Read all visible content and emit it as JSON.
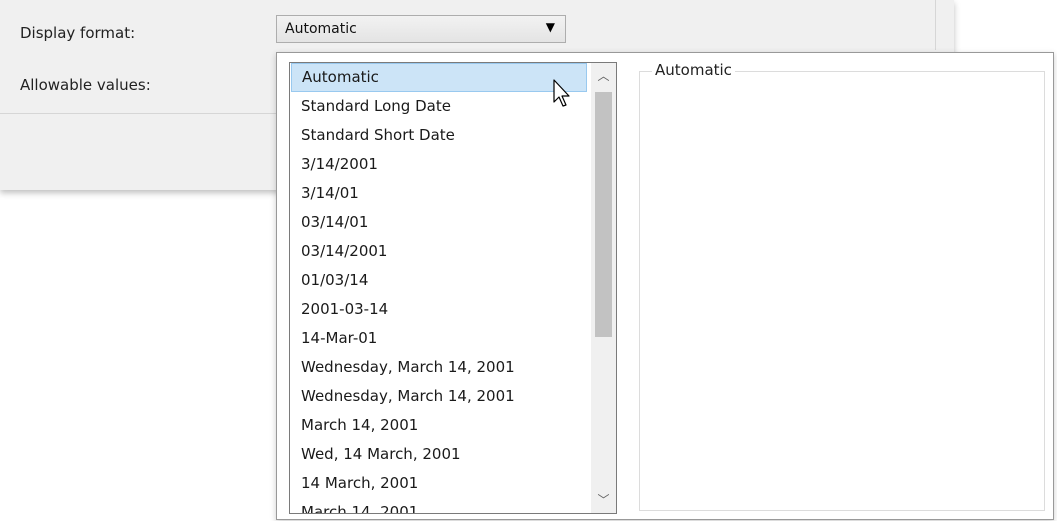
{
  "dialog": {
    "display_format_label": "Display format:",
    "allowable_values_label": "Allowable values:"
  },
  "combo": {
    "value": "Automatic",
    "arrow_icon": "dropdown-arrow-icon"
  },
  "dropdown": {
    "options": [
      "Automatic",
      "Standard Long Date",
      "Standard Short Date",
      "3/14/2001",
      "3/14/01",
      "03/14/01",
      "03/14/2001",
      "01/03/14",
      "2001-03-14",
      "14-Mar-01",
      "Wednesday, March 14, 2001",
      "Wednesday, March 14, 2001",
      "March 14, 2001",
      "Wed, 14 March, 2001",
      "14 March, 2001",
      "March 14, 2001"
    ],
    "selected_index": 0,
    "preview_title": "Automatic"
  },
  "colors": {
    "selection_bg": "#cce4f7",
    "selection_border": "#99c9ef",
    "dialog_bg": "#f0f0f0"
  }
}
